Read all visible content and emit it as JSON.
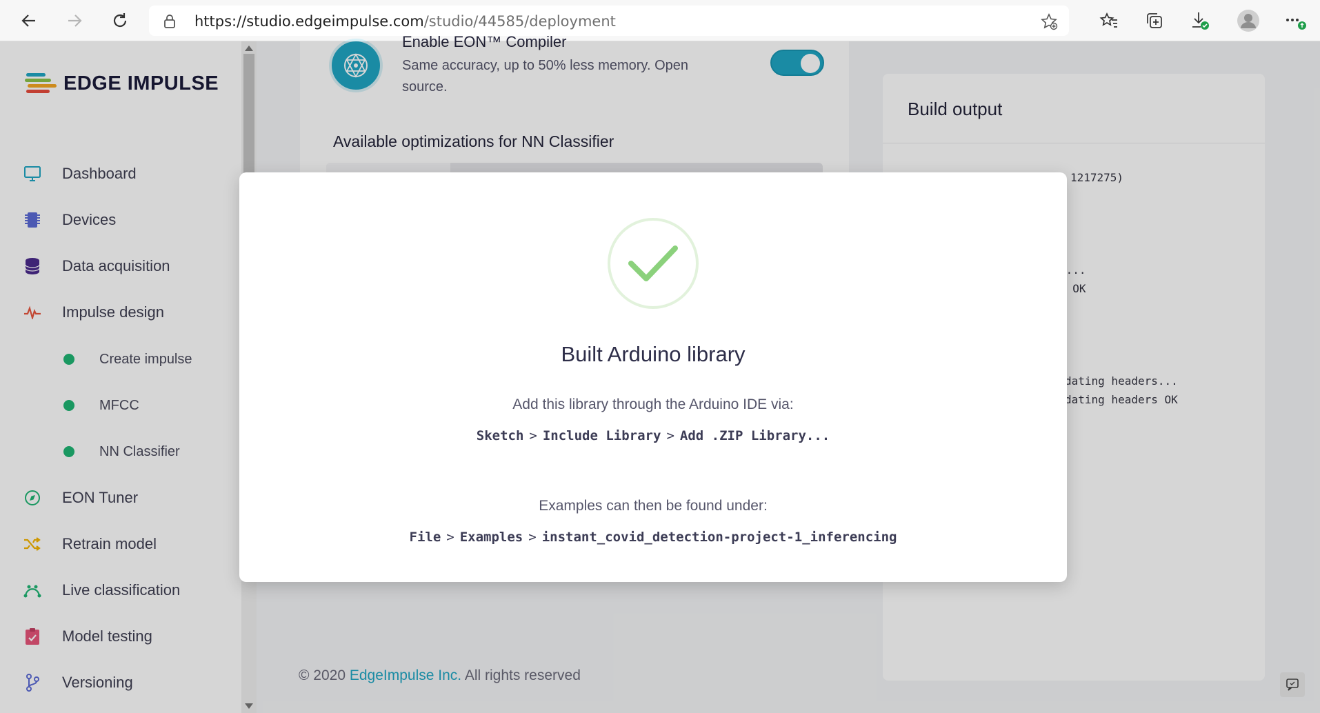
{
  "browser": {
    "url_host": "https://studio.edgeimpulse.com",
    "url_path": "/studio/44585/deployment"
  },
  "sidebar": {
    "logo_text": "EDGE IMPULSE",
    "items": [
      {
        "label": "Dashboard",
        "icon": "monitor-icon"
      },
      {
        "label": "Devices",
        "icon": "chip-icon"
      },
      {
        "label": "Data acquisition",
        "icon": "database-icon"
      },
      {
        "label": "Impulse design",
        "icon": "pulse-icon"
      },
      {
        "label": "EON Tuner",
        "icon": "compass-icon"
      },
      {
        "label": "Retrain model",
        "icon": "shuffle-icon"
      },
      {
        "label": "Live classification",
        "icon": "curve-icon"
      },
      {
        "label": "Model testing",
        "icon": "clipboard-check-icon"
      },
      {
        "label": "Versioning",
        "icon": "branch-icon"
      }
    ],
    "sub_items": [
      {
        "label": "Create impulse"
      },
      {
        "label": "MFCC"
      },
      {
        "label": "NN Classifier"
      }
    ]
  },
  "main": {
    "eon_title": "Enable EON™ Compiler",
    "eon_desc": "Same accuracy, up to 50% less memory. Open source.",
    "eon_enabled": true,
    "optimizations_title": "Available optimizations for NN Classifier"
  },
  "build": {
    "title": "Build output",
    "log_fragments": [
      "1217275)",
      "X...",
      "K OK",
      "dating headers...",
      "dating headers OK"
    ]
  },
  "footer": {
    "copyright": "© 2020",
    "company": "EdgeImpulse Inc.",
    "rights": "All rights reserved"
  },
  "modal": {
    "title": "Built Arduino library",
    "instruction": "Add this library through the Arduino IDE via:",
    "path1": [
      "Sketch",
      "Include Library",
      "Add .ZIP Library..."
    ],
    "examples_text": "Examples can then be found under:",
    "path2": [
      "File",
      "Examples",
      "instant_covid_detection-project-1_inferencing"
    ],
    "success_color": "#8bd17c"
  }
}
